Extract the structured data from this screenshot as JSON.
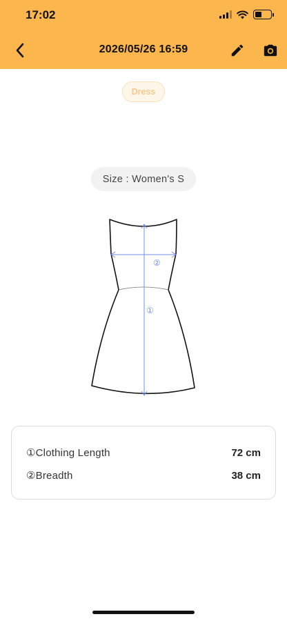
{
  "status_bar": {
    "time": "17:02",
    "icons": [
      "signal-icon",
      "wifi-icon",
      "battery-icon"
    ],
    "battery_level": 0.45
  },
  "nav": {
    "back_icon": "chevron-left-icon",
    "title": "2026/05/26 16:59",
    "edit_icon": "pencil-icon",
    "camera_icon": "camera-icon"
  },
  "category_tag": "Dress",
  "size_chip": "Size : Women's S",
  "diagram": {
    "markers": [
      "①",
      "②"
    ],
    "line_color": "#6F8FE6"
  },
  "measurements": [
    {
      "label": "①Clothing Length",
      "value": "72 cm"
    },
    {
      "label": "②Breadth",
      "value": "38 cm"
    }
  ],
  "colors": {
    "header_bg": "#FBB64E",
    "tag_text": "#F8C98A",
    "chip_bg": "#F2F2F2"
  }
}
